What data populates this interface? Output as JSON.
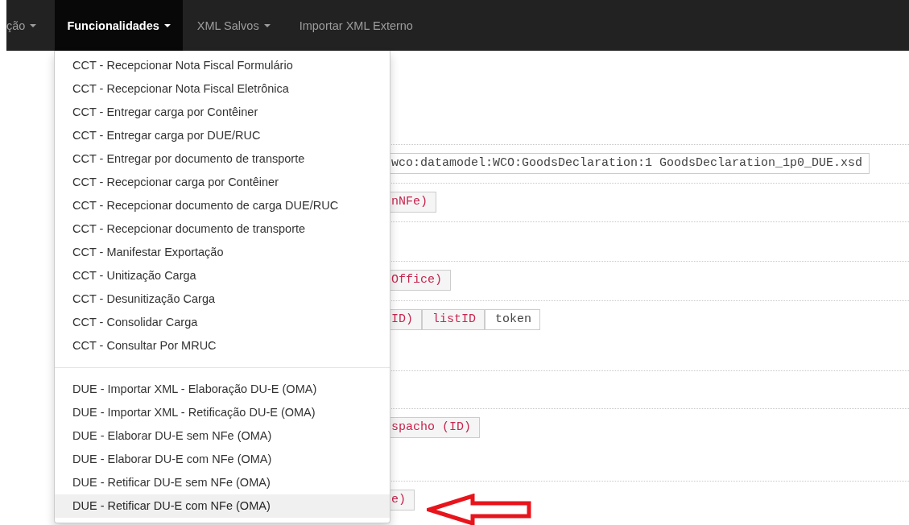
{
  "navbar": {
    "items": [
      {
        "label": "ção",
        "caret": true,
        "selected": false
      },
      {
        "label": "Funcionalidades",
        "caret": true,
        "selected": true
      },
      {
        "label": "XML Salvos",
        "caret": true,
        "selected": false
      },
      {
        "label": "Importar XML Externo",
        "caret": false,
        "selected": false
      }
    ]
  },
  "sections": [
    {
      "kind": "chips",
      "chips": [
        {
          "kind": "plain",
          "text": "wco:datamodel:WCO:GoodsDeclaration:1 GoodsDeclaration_1p0_DUE.xsd"
        }
      ]
    },
    {
      "kind": "chips",
      "chips": [
        {
          "kind": "code",
          "text": "nNFe)"
        }
      ]
    },
    {
      "kind": "blank"
    },
    {
      "kind": "chips",
      "chips": [
        {
          "kind": "code",
          "text": "Office)"
        }
      ]
    },
    {
      "kind": "chips",
      "chips": [
        {
          "kind": "code",
          "text": "ID)"
        },
        {
          "kind": "code",
          "text": "listID"
        },
        {
          "kind": "plain",
          "text": "token"
        }
      ]
    },
    {
      "kind": "blank"
    },
    {
      "kind": "chips",
      "chips": [
        {
          "kind": "code",
          "text": "spacho (ID)"
        }
      ]
    },
    {
      "kind": "chips",
      "chips": [
        {
          "kind": "code",
          "text": "e)"
        }
      ]
    }
  ],
  "dropdown": {
    "groups": [
      {
        "items": [
          {
            "label": "CCT - Recepcionar Nota Fiscal Formulário",
            "selected": false
          },
          {
            "label": "CCT - Recepcionar Nota Fiscal Eletrônica",
            "selected": false
          },
          {
            "label": "CCT - Entregar carga por Contêiner",
            "selected": false
          },
          {
            "label": "CCT - Entregar carga por DUE/RUC",
            "selected": false
          },
          {
            "label": "CCT - Entregar por documento de transporte",
            "selected": false
          },
          {
            "label": "CCT - Recepcionar carga por Contêiner",
            "selected": false
          },
          {
            "label": "CCT - Recepcionar documento de carga DUE/RUC",
            "selected": false
          },
          {
            "label": "CCT - Recepcionar documento de transporte",
            "selected": false
          },
          {
            "label": "CCT - Manifestar Exportação",
            "selected": false
          },
          {
            "label": "CCT - Unitização Carga",
            "selected": false
          },
          {
            "label": "CCT - Desunitização Carga",
            "selected": false
          },
          {
            "label": "CCT - Consolidar Carga",
            "selected": false
          },
          {
            "label": "CCT - Consultar Por MRUC",
            "selected": false
          }
        ]
      },
      {
        "items": [
          {
            "label": "DUE - Importar XML - Elaboração DU-E (OMA)",
            "selected": false
          },
          {
            "label": "DUE - Importar XML - Retificação DU-E (OMA)",
            "selected": false
          },
          {
            "label": "DUE - Elaborar DU-E sem NFe (OMA)",
            "selected": false
          },
          {
            "label": "DUE - Elaborar DU-E com NFe (OMA)",
            "selected": false
          },
          {
            "label": "DUE - Retificar DU-E sem NFe (OMA)",
            "selected": false
          },
          {
            "label": "DUE - Retificar DU-E com NFe (OMA)",
            "selected": true
          }
        ]
      }
    ]
  }
}
